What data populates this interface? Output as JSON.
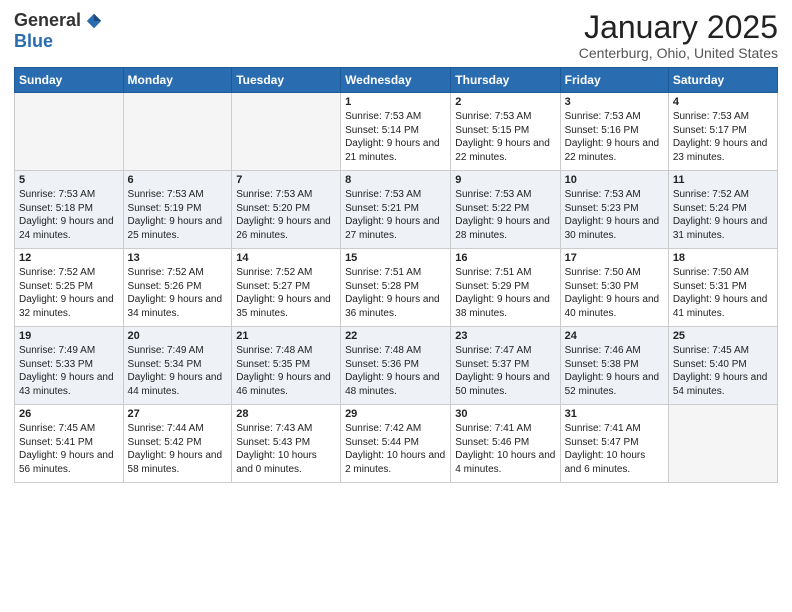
{
  "logo": {
    "general": "General",
    "blue": "Blue"
  },
  "header": {
    "month": "January 2025",
    "location": "Centerburg, Ohio, United States"
  },
  "weekdays": [
    "Sunday",
    "Monday",
    "Tuesday",
    "Wednesday",
    "Thursday",
    "Friday",
    "Saturday"
  ],
  "weeks": [
    [
      {
        "day": "",
        "text": ""
      },
      {
        "day": "",
        "text": ""
      },
      {
        "day": "",
        "text": ""
      },
      {
        "day": "1",
        "text": "Sunrise: 7:53 AM\nSunset: 5:14 PM\nDaylight: 9 hours and 21 minutes."
      },
      {
        "day": "2",
        "text": "Sunrise: 7:53 AM\nSunset: 5:15 PM\nDaylight: 9 hours and 22 minutes."
      },
      {
        "day": "3",
        "text": "Sunrise: 7:53 AM\nSunset: 5:16 PM\nDaylight: 9 hours and 22 minutes."
      },
      {
        "day": "4",
        "text": "Sunrise: 7:53 AM\nSunset: 5:17 PM\nDaylight: 9 hours and 23 minutes."
      }
    ],
    [
      {
        "day": "5",
        "text": "Sunrise: 7:53 AM\nSunset: 5:18 PM\nDaylight: 9 hours and 24 minutes."
      },
      {
        "day": "6",
        "text": "Sunrise: 7:53 AM\nSunset: 5:19 PM\nDaylight: 9 hours and 25 minutes."
      },
      {
        "day": "7",
        "text": "Sunrise: 7:53 AM\nSunset: 5:20 PM\nDaylight: 9 hours and 26 minutes."
      },
      {
        "day": "8",
        "text": "Sunrise: 7:53 AM\nSunset: 5:21 PM\nDaylight: 9 hours and 27 minutes."
      },
      {
        "day": "9",
        "text": "Sunrise: 7:53 AM\nSunset: 5:22 PM\nDaylight: 9 hours and 28 minutes."
      },
      {
        "day": "10",
        "text": "Sunrise: 7:53 AM\nSunset: 5:23 PM\nDaylight: 9 hours and 30 minutes."
      },
      {
        "day": "11",
        "text": "Sunrise: 7:52 AM\nSunset: 5:24 PM\nDaylight: 9 hours and 31 minutes."
      }
    ],
    [
      {
        "day": "12",
        "text": "Sunrise: 7:52 AM\nSunset: 5:25 PM\nDaylight: 9 hours and 32 minutes."
      },
      {
        "day": "13",
        "text": "Sunrise: 7:52 AM\nSunset: 5:26 PM\nDaylight: 9 hours and 34 minutes."
      },
      {
        "day": "14",
        "text": "Sunrise: 7:52 AM\nSunset: 5:27 PM\nDaylight: 9 hours and 35 minutes."
      },
      {
        "day": "15",
        "text": "Sunrise: 7:51 AM\nSunset: 5:28 PM\nDaylight: 9 hours and 36 minutes."
      },
      {
        "day": "16",
        "text": "Sunrise: 7:51 AM\nSunset: 5:29 PM\nDaylight: 9 hours and 38 minutes."
      },
      {
        "day": "17",
        "text": "Sunrise: 7:50 AM\nSunset: 5:30 PM\nDaylight: 9 hours and 40 minutes."
      },
      {
        "day": "18",
        "text": "Sunrise: 7:50 AM\nSunset: 5:31 PM\nDaylight: 9 hours and 41 minutes."
      }
    ],
    [
      {
        "day": "19",
        "text": "Sunrise: 7:49 AM\nSunset: 5:33 PM\nDaylight: 9 hours and 43 minutes."
      },
      {
        "day": "20",
        "text": "Sunrise: 7:49 AM\nSunset: 5:34 PM\nDaylight: 9 hours and 44 minutes."
      },
      {
        "day": "21",
        "text": "Sunrise: 7:48 AM\nSunset: 5:35 PM\nDaylight: 9 hours and 46 minutes."
      },
      {
        "day": "22",
        "text": "Sunrise: 7:48 AM\nSunset: 5:36 PM\nDaylight: 9 hours and 48 minutes."
      },
      {
        "day": "23",
        "text": "Sunrise: 7:47 AM\nSunset: 5:37 PM\nDaylight: 9 hours and 50 minutes."
      },
      {
        "day": "24",
        "text": "Sunrise: 7:46 AM\nSunset: 5:38 PM\nDaylight: 9 hours and 52 minutes."
      },
      {
        "day": "25",
        "text": "Sunrise: 7:45 AM\nSunset: 5:40 PM\nDaylight: 9 hours and 54 minutes."
      }
    ],
    [
      {
        "day": "26",
        "text": "Sunrise: 7:45 AM\nSunset: 5:41 PM\nDaylight: 9 hours and 56 minutes."
      },
      {
        "day": "27",
        "text": "Sunrise: 7:44 AM\nSunset: 5:42 PM\nDaylight: 9 hours and 58 minutes."
      },
      {
        "day": "28",
        "text": "Sunrise: 7:43 AM\nSunset: 5:43 PM\nDaylight: 10 hours and 0 minutes."
      },
      {
        "day": "29",
        "text": "Sunrise: 7:42 AM\nSunset: 5:44 PM\nDaylight: 10 hours and 2 minutes."
      },
      {
        "day": "30",
        "text": "Sunrise: 7:41 AM\nSunset: 5:46 PM\nDaylight: 10 hours and 4 minutes."
      },
      {
        "day": "31",
        "text": "Sunrise: 7:41 AM\nSunset: 5:47 PM\nDaylight: 10 hours and 6 minutes."
      },
      {
        "day": "",
        "text": ""
      }
    ]
  ]
}
